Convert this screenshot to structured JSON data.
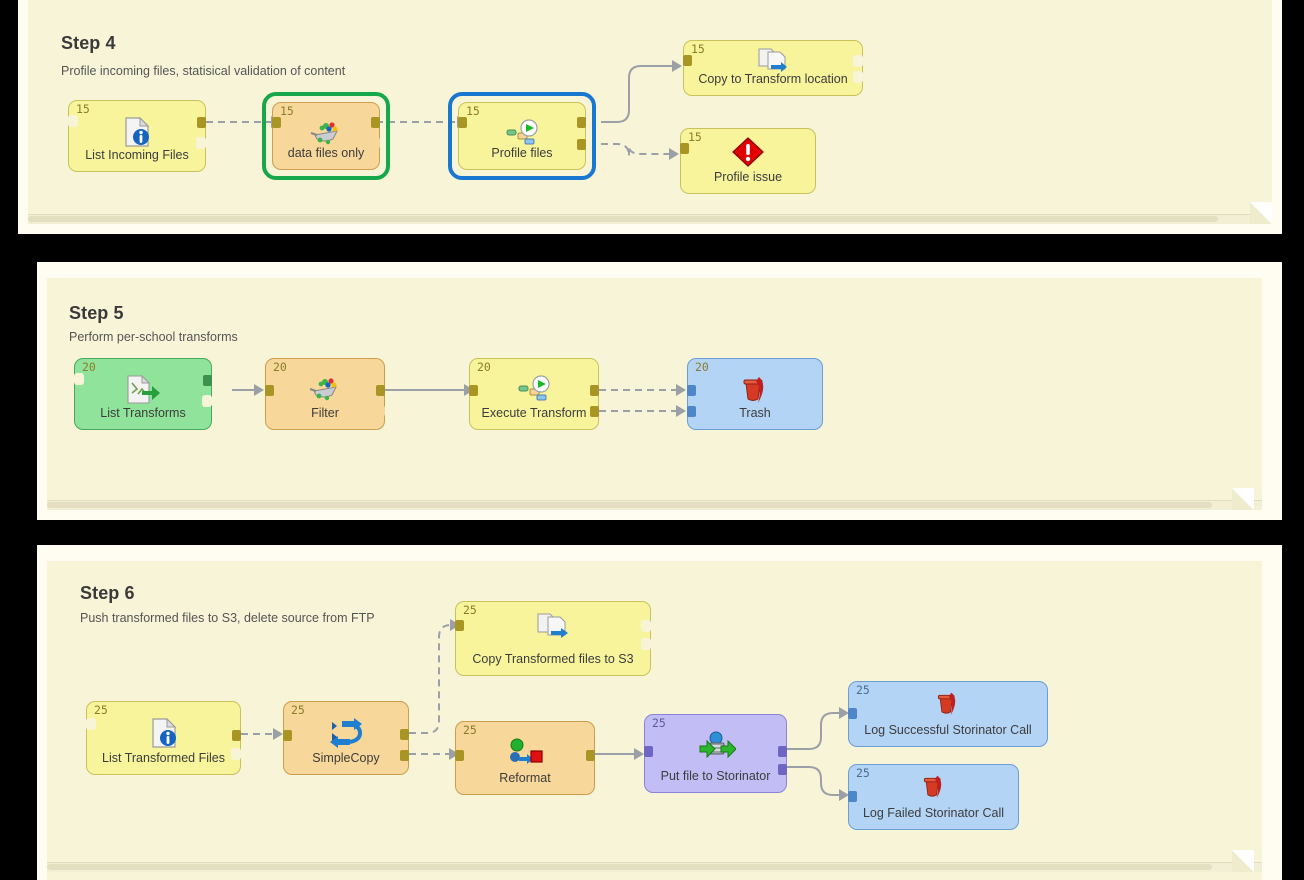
{
  "theme": {
    "background": "#000000",
    "frame_bg": "#fffdf2",
    "canvas_bg": "#f8f4d8",
    "wire_color": "#9aa0a6",
    "node_yellow": "#f7f49c",
    "node_orange": "#f7d79a",
    "node_green": "#8fe39a",
    "node_blue": "#b4d4f6",
    "node_purple": "#c2bdf5",
    "selection_green": "#17a84c",
    "selection_blue": "#1878d0",
    "badge_color": "#8a7d2b"
  },
  "steps": [
    {
      "id": "step4",
      "title": "Step 4",
      "subtitle": "Profile incoming files, statisical validation of content",
      "nodes": [
        {
          "id": "list-incoming-files",
          "label": "List Incoming Files",
          "badge": "15",
          "color": "yellow",
          "icon": "file-info-icon"
        },
        {
          "id": "data-files-only",
          "label": "data files only",
          "badge": "15",
          "color": "orange",
          "icon": "filter-funnel-icon",
          "selected": "green"
        },
        {
          "id": "profile-files",
          "label": "Profile files",
          "badge": "15",
          "color": "yellow",
          "icon": "execute-play-icon",
          "selected": "blue"
        },
        {
          "id": "copy-to-transform-location",
          "label": "Copy to Transform location",
          "badge": "15",
          "color": "yellow",
          "icon": "copy-files-icon"
        },
        {
          "id": "profile-issue",
          "label": "Profile issue",
          "badge": "15",
          "color": "yellow",
          "icon": "error-diamond-icon"
        }
      ]
    },
    {
      "id": "step5",
      "title": "Step 5",
      "subtitle": "Perform per-school transforms",
      "nodes": [
        {
          "id": "list-transforms",
          "label": "List Transforms",
          "badge": "20",
          "color": "green",
          "icon": "list-arrow-icon"
        },
        {
          "id": "filter",
          "label": "Filter",
          "badge": "20",
          "color": "orange",
          "icon": "filter-funnel-icon"
        },
        {
          "id": "execute-transform",
          "label": "Execute Transform",
          "badge": "20",
          "color": "yellow",
          "icon": "execute-play-icon"
        },
        {
          "id": "trash",
          "label": "Trash",
          "badge": "20",
          "color": "blue",
          "icon": "trash-icon"
        }
      ]
    },
    {
      "id": "step6",
      "title": "Step 6",
      "subtitle": "Push transformed files to S3, delete source from FTP",
      "nodes": [
        {
          "id": "copy-transformed-files-to-s3",
          "label": "Copy Transformed files to S3",
          "badge": "25",
          "color": "yellow",
          "icon": "copy-files-icon"
        },
        {
          "id": "list-transformed-files",
          "label": "List Transformed Files",
          "badge": "25",
          "color": "yellow",
          "icon": "file-info-icon"
        },
        {
          "id": "simplecopy",
          "label": "SimpleCopy",
          "badge": "25",
          "color": "orange",
          "icon": "simplecopy-arrows-icon"
        },
        {
          "id": "reformat",
          "label": "Reformat",
          "badge": "25",
          "color": "orange",
          "icon": "reformat-icon"
        },
        {
          "id": "put-file-to-storinator",
          "label": "Put file to Storinator",
          "badge": "25",
          "color": "purple",
          "icon": "upload-server-icon"
        },
        {
          "id": "log-successful-storinator-call",
          "label": "Log Successful Storinator Call",
          "badge": "25",
          "color": "blue",
          "icon": "trash-icon"
        },
        {
          "id": "log-failed-storinator-call",
          "label": "Log Failed Storinator Call",
          "badge": "25",
          "color": "blue",
          "icon": "trash-icon"
        }
      ]
    }
  ]
}
